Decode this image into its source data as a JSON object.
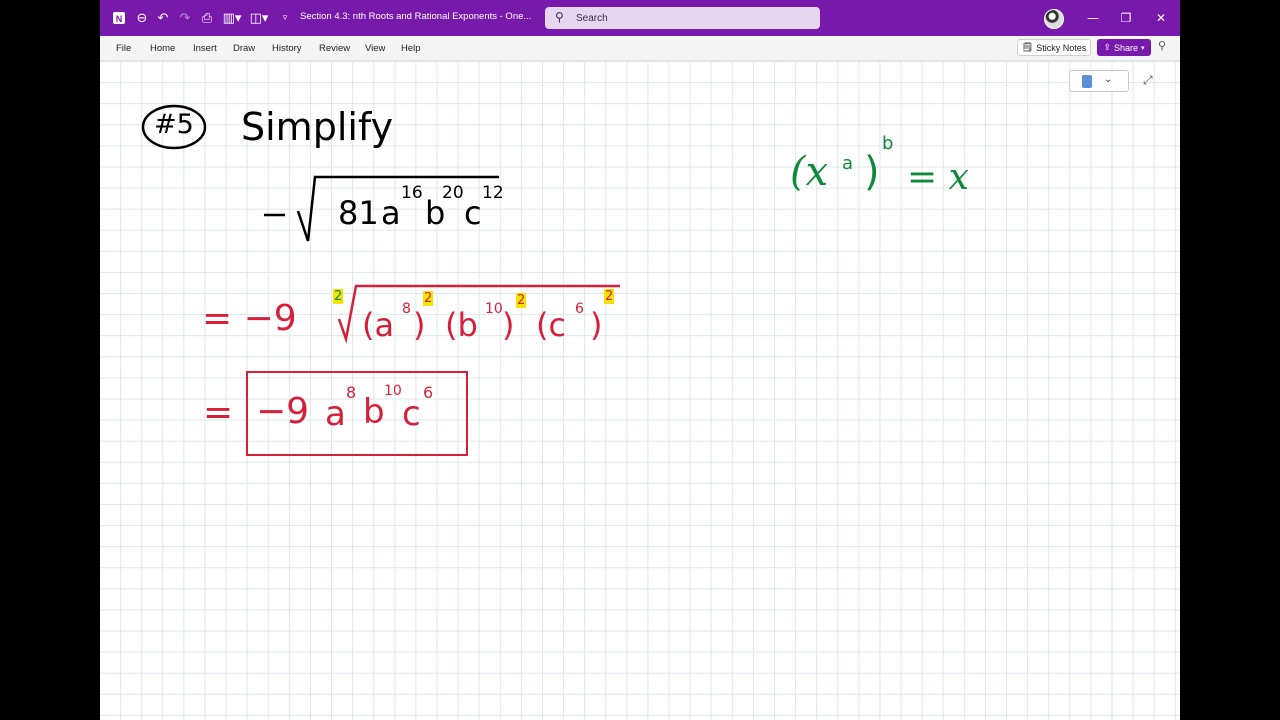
{
  "titlebar": {
    "doc_title": "Section 4.3: nth Roots and Rational Exponents  -  One...",
    "search_placeholder": "Search",
    "icons": [
      "onenote-icon",
      "back-icon",
      "undo-icon",
      "redo-icon",
      "print-icon",
      "layout-icon",
      "shapes-icon",
      "customize-icon"
    ]
  },
  "menu": {
    "items": [
      "File",
      "Home",
      "Insert",
      "Draw",
      "History",
      "Review",
      "View",
      "Help"
    ],
    "sticky_notes": "Sticky Notes",
    "share": "Share"
  },
  "ink": {
    "problem_label": "#5",
    "instruction": "Simplify",
    "expression": "−√(81 a¹⁶ b²⁰ c¹²)",
    "coef_81": "81",
    "var_a": "a",
    "exp_16": "16",
    "var_b": "b",
    "exp_20": "20",
    "var_c": "c",
    "exp_12": "12",
    "step1_prefix": "= −9",
    "index2": "2",
    "step1_terms": [
      "(a",
      "8",
      ")",
      "(b",
      "10",
      ")",
      "(c",
      "6",
      ")"
    ],
    "answer_equals": "=",
    "answer": "−9 a⁸ b¹⁰ c⁶",
    "ans_coef": "−9",
    "ans_a_exp": "8",
    "ans_b_exp": "10",
    "ans_c_exp": "6",
    "rule_lhs_open": "(x",
    "rule_a": "a",
    "rule_close": ")",
    "rule_b": "b",
    "rule_eq": "= x"
  },
  "colors": {
    "brand": "#7719aa",
    "black_ink": "#000000",
    "red_ink": "#d71f3a",
    "green_ink": "#0e8a3a",
    "highlight": "#f5e400"
  }
}
